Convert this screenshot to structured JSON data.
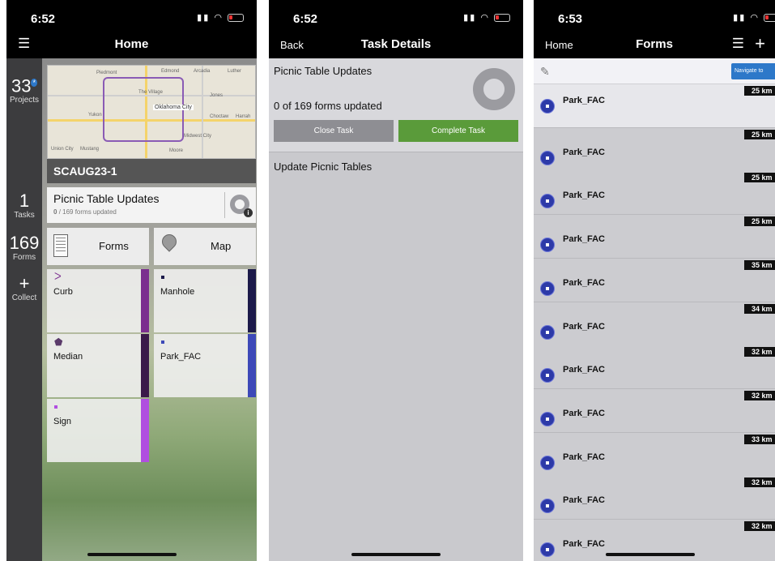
{
  "screens": {
    "home": {
      "time": "6:52",
      "title": "Home",
      "rail": {
        "projects": {
          "count": "33",
          "label": "Projects",
          "badge": "*"
        },
        "tasks": {
          "count": "1",
          "label": "Tasks"
        },
        "forms": {
          "count": "169",
          "label": "Forms"
        },
        "collect": {
          "icon": "+",
          "label": "Collect"
        }
      },
      "map": {
        "city_label": "Oklahoma City",
        "places": [
          "Edmond",
          "Piedmont",
          "Arcadia",
          "Luther",
          "Jones",
          "Yukon",
          "Mustang",
          "Moore",
          "The Village",
          "Midwest City",
          "Harrah",
          "Union City",
          "Choctaw"
        ]
      },
      "project_name": "SCAUG23-1",
      "task": {
        "title": "Picnic Table Updates",
        "count": "0",
        "subtitle": "/ 169 forms updated",
        "progress": 0
      },
      "forms_button": "Forms",
      "map_button": "Map",
      "layers": [
        {
          "name": "Curb",
          "color": "#7b2e8f",
          "icon": "curb-line-icon"
        },
        {
          "name": "Manhole",
          "color": "#1c1a4a",
          "icon": "manhole-point-icon"
        },
        {
          "name": "Median",
          "color": "#3a1a4a",
          "icon": "median-polygon-icon"
        },
        {
          "name": "Park_FAC",
          "color": "#3d49b8",
          "icon": "park-point-icon"
        },
        {
          "name": "Sign",
          "color": "#b04ee0",
          "icon": "sign-point-icon"
        }
      ]
    },
    "task_details": {
      "time": "6:52",
      "back": "Back",
      "title": "Task Details",
      "task_name": "Picnic Table Updates",
      "progress_text": "0 of 169 forms updated",
      "progress": 0,
      "close_button": "Close Task",
      "complete_button": "Complete Task",
      "form_template": "Update Picnic Tables"
    },
    "forms": {
      "time": "6:53",
      "back": "Home",
      "title": "Forms",
      "navigate_button": "Navigate to",
      "items": [
        {
          "name": "Park_FAC",
          "distance": "25 km"
        },
        {
          "name": "Park_FAC",
          "distance": "25 km"
        },
        {
          "name": "Park_FAC",
          "distance": "25 km"
        },
        {
          "name": "Park_FAC",
          "distance": "25 km"
        },
        {
          "name": "Park_FAC",
          "distance": "35 km"
        },
        {
          "name": "Park_FAC",
          "distance": "34 km"
        },
        {
          "name": "Park_FAC",
          "distance": "32 km"
        },
        {
          "name": "Park_FAC",
          "distance": "32 km"
        },
        {
          "name": "Park_FAC",
          "distance": "33 km"
        },
        {
          "name": "Park_FAC",
          "distance": "32 km"
        },
        {
          "name": "Park_FAC",
          "distance": "32 km"
        }
      ]
    }
  }
}
